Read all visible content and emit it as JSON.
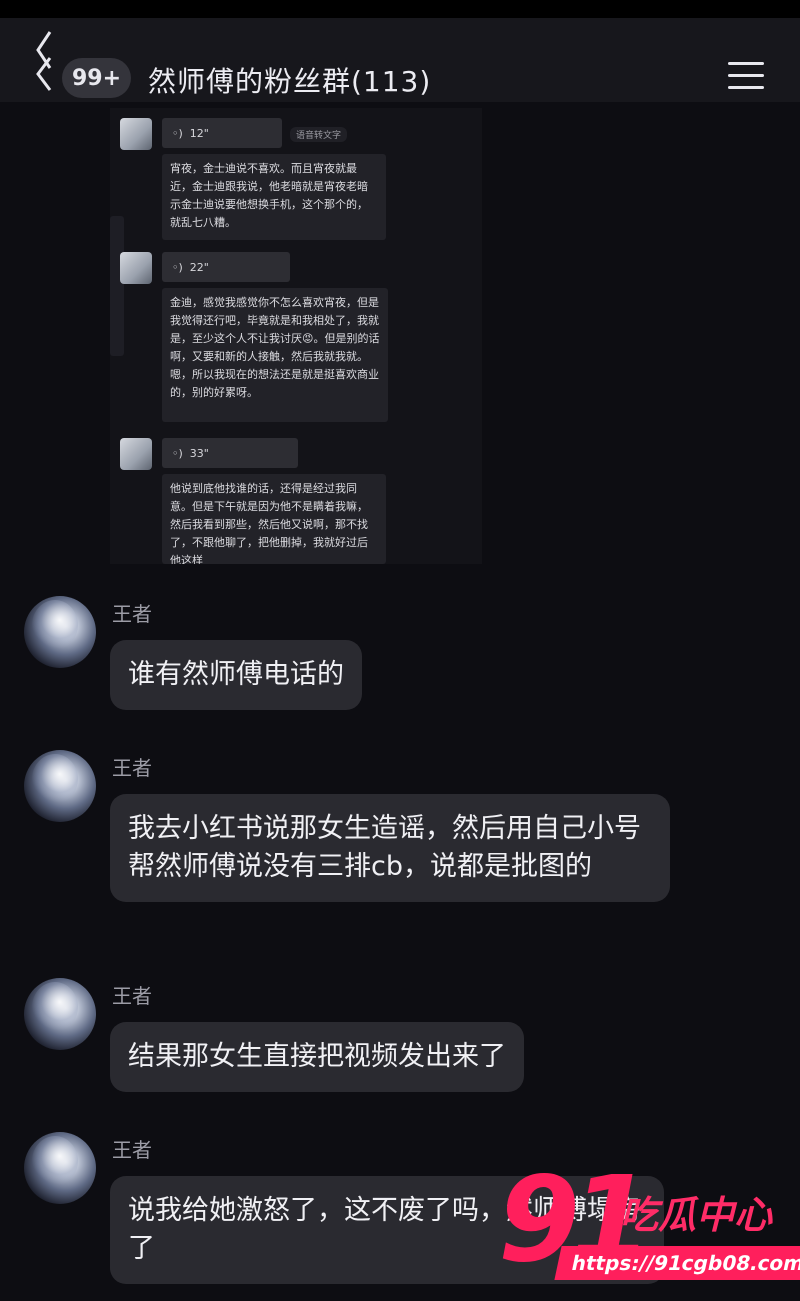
{
  "header": {
    "unread_badge": "99+",
    "title": "然师傅的粉丝群(113)"
  },
  "embedded_chat": [
    {
      "voice_duration": "12\"",
      "transcribe_label": "语音转文字",
      "transcript": "宵夜，金士迪说不喜欢。而且宵夜就最近，金士迪跟我说，他老暗就是宵夜老暗示金士迪说要他想换手机，这个那个的，就乱七八糟。"
    },
    {
      "voice_duration": "22\"",
      "transcript": "金迪，感觉我感觉你不怎么喜欢宵夜，但是我觉得还行吧，毕竟就是和我相处了，我就是，至少这个人不让我讨厌😡。但是别的话啊，又要和新的人接触，然后我就我就。嗯，所以我现在的想法还是就是挺喜欢商业的，别的好累呀。"
    },
    {
      "voice_duration": "33\"",
      "transcript": "他说到底他找谁的话，还得是经过我同意。但是下午就是因为他不是瞒着我嘛，然后我看到那些，然后他又说啊，那不找了，不跟他聊了，把他删掉，我就好过后他这样"
    }
  ],
  "messages": [
    {
      "sender": "王者",
      "text": "谁有然师傅电话的"
    },
    {
      "sender": "王者",
      "text": "我去小红书说那女生造谣，然后用自己小号帮然师傅说没有三排cb，说都是批图的"
    },
    {
      "sender": "王者",
      "text": "结果那女生直接把视频发出来了"
    },
    {
      "sender": "王者",
      "text": "说我给她激怒了，这不废了吗，然师傅塌房了"
    }
  ],
  "watermark": {
    "number": "91",
    "brand": "吃瓜中心",
    "url": "https://91cgb08.com"
  },
  "colors": {
    "background": "#0d0d12",
    "bubble": "#2a2a30",
    "watermark": "#ff1f5c"
  }
}
